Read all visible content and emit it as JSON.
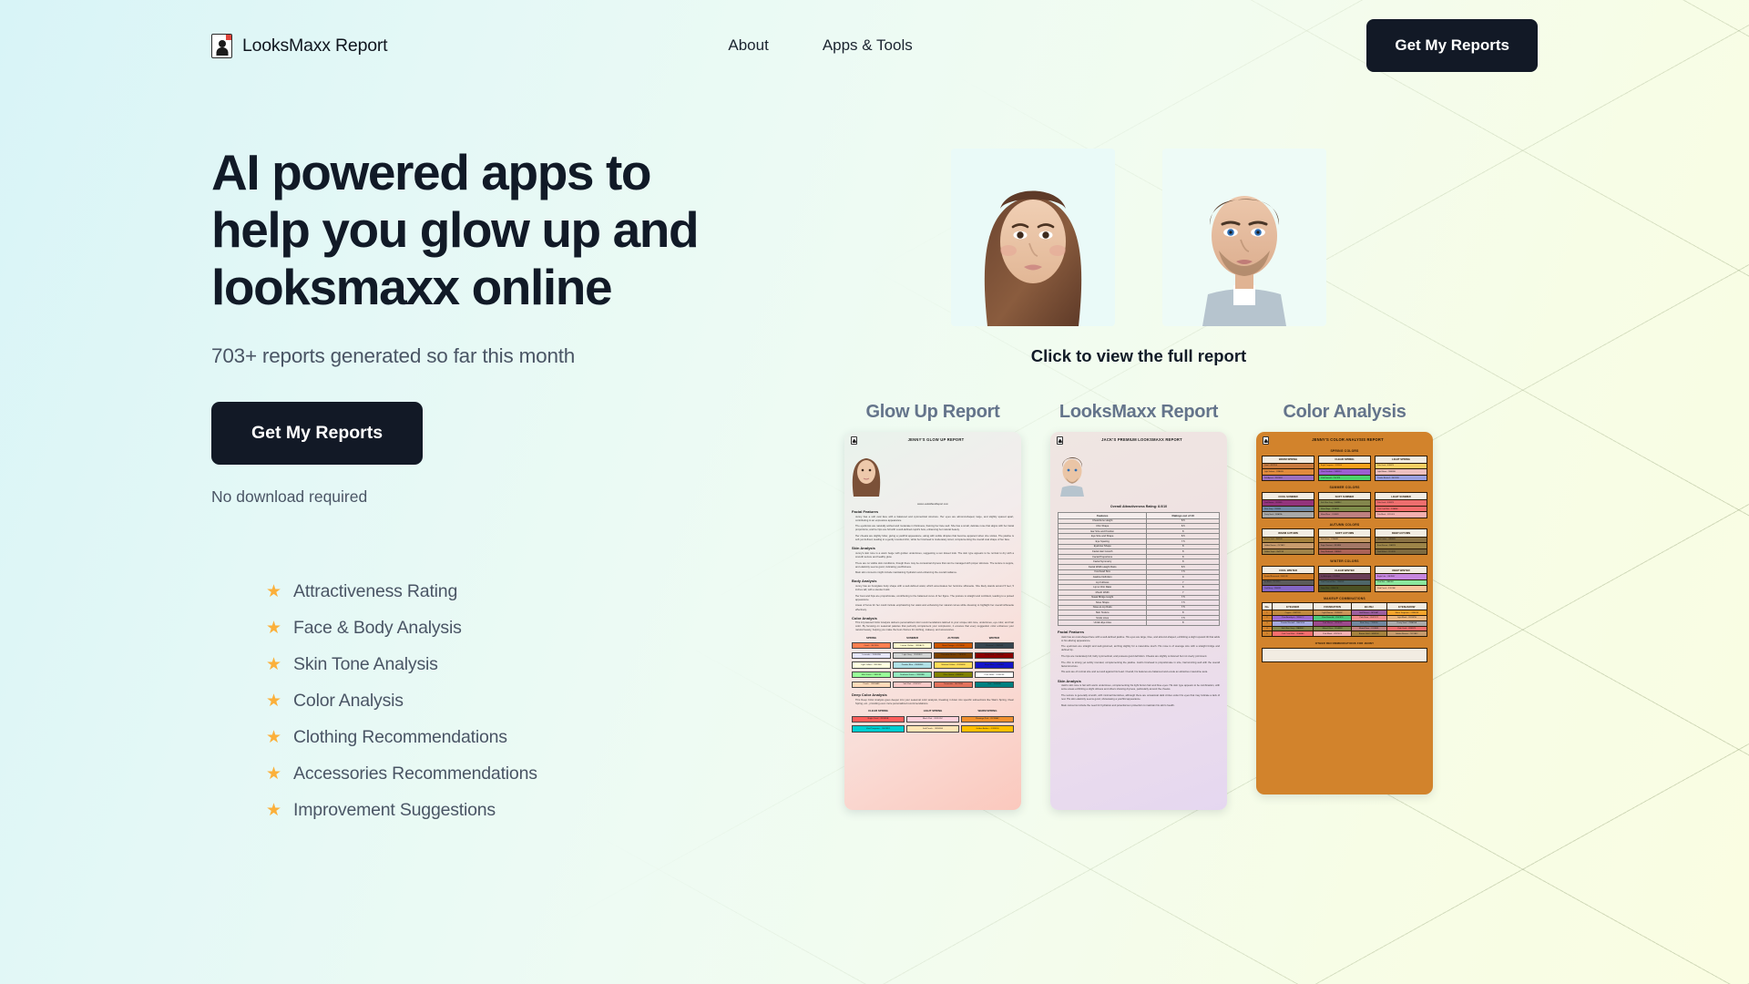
{
  "header": {
    "brand_name": "LooksMaxx Report",
    "brand_logo_icon": "report-person-icon",
    "nav": [
      {
        "label": "About"
      },
      {
        "label": "Apps & Tools"
      }
    ],
    "cta_label": "Get My Reports"
  },
  "hero": {
    "heading": "AI powered apps to help you glow up and looksmaxx online",
    "subheading": "703+ reports generated so far this month",
    "cta_label": "Get My Reports",
    "note": "No download required",
    "features": [
      {
        "icon": "star-icon",
        "label": "Attractiveness Rating"
      },
      {
        "icon": "star-icon",
        "label": "Face & Body Analysis"
      },
      {
        "icon": "star-icon",
        "label": "Skin Tone Analysis"
      },
      {
        "icon": "star-icon",
        "label": "Color Analysis"
      },
      {
        "icon": "star-icon",
        "label": "Clothing Recommendations"
      },
      {
        "icon": "star-icon",
        "label": "Accessories Recommendations"
      },
      {
        "icon": "star-icon",
        "label": "Improvement Suggestions"
      }
    ],
    "star_color": "#fbb03b",
    "accent_dark": "#121926"
  },
  "showcase": {
    "click_note": "Click to view the full report",
    "portraits": [
      {
        "alt": "female-portrait"
      },
      {
        "alt": "male-portrait"
      }
    ],
    "cards": [
      {
        "title": "Glow Up Report"
      },
      {
        "title": "LooksMaxx Report"
      },
      {
        "title": "Color Analysis"
      }
    ]
  },
  "glow_up_report": {
    "title": "JENNY'S GLOW UP REPORT",
    "url": "www.LooksMaxxReport.com",
    "sections": [
      {
        "heading": "Facial Features",
        "paragraphs": [
          "Jenny has a soft oval face with a balanced and symmetrical structure. Her eyes are almond-shaped, large, and slightly spaced apart, contributing to an expressive appearance.",
          "The eyebrows are naturally arched and moderate in thickness, framing her face well. She has a small, delicate nose that aligns with her facial proportions, and her lips are full with a well-defined cupid's bow, enhancing her natural beauty.",
          "Her cheeks are slightly fuller, giving a youthful appearance, along with subtle dimples that become apparent when she smiles. The jawline is soft yet defined, leading to a gently rounded chin, while her forehead is moderately sized, complementing the overall oval shape of her face."
        ]
      },
      {
        "heading": "Skin Analysis",
        "paragraphs": [
          "Jenny's skin tone is a warm beige with golden undertones, suggesting a sun kissed look. The skin type appears to be normal to dry with a smooth texture and healthy glow.",
          "There are no visible skin conditions, though there may be occasional dryness that can be managed with proper skincare. The texture is supple, and elasticity seems good, indicating youthfulness.",
          "Main skin concerns might include maintaining hydration and enhancing the overall radiance."
        ]
      },
      {
        "heading": "Body Analysis",
        "paragraphs": [
          "Jenny has an hourglass body shape with a well-defined waist, which accentuates her feminine silhouette. She likely stands around 5 feet, 5 inches tall, with a slender build.",
          "Her bust and hips are proportionate, contributing to the balanced curve of her figure. The posture is straight and confident, leading to a poised appearance.",
          "Areas of focus for her could include emphasizing her waist and enhancing her natural curves while dressing to highlight her overall silhouette effectively."
        ]
      },
      {
        "heading": "Color Analysis",
        "paragraphs": [
          "This AI powered Color Analysis delivers personalized color recommendations tailored to your unique skin tone, undertones, eye color, and hair color. By focusing on seasonal palettes that perfectly complement your complexion, it ensures that every suggestion color enhances your natural beauty, helping you make the best choices for clothing, makeup, and accessories."
        ]
      }
    ],
    "season_columns": [
      "SPRING",
      "SUMMER",
      "AUTUMN",
      "WINTER"
    ],
    "season_swatches": [
      [
        {
          "label": "Coral - #FF7F50",
          "color": "#FF7F50"
        },
        {
          "label": "Lavender - #E6E6FA",
          "color": "#E6E6FA"
        },
        {
          "label": "Light Yellow - #FFFFE0",
          "color": "#FFFFE0"
        },
        {
          "label": "Mint Green - #98FF98",
          "color": "#98FF98"
        },
        {
          "label": "Peach - #FFDAB9",
          "color": "#FFDAB9"
        }
      ],
      [
        {
          "label": "Lemon Chiffon - #FFFACD",
          "color": "#FFFACD"
        },
        {
          "label": "Light Grey - #D3D3D3",
          "color": "#D3D3D3"
        },
        {
          "label": "Powder Blue - #B0E0E6",
          "color": "#B0E0E6"
        },
        {
          "label": "Seafoam Green - #93E9BE",
          "color": "#93E9BE"
        },
        {
          "label": "Soft Pink - #F9C9C7",
          "color": "#F9C9C7"
        }
      ],
      [
        {
          "label": "Burnt Orange - #CC5500",
          "color": "#CC5500"
        },
        {
          "label": "Chocolate Brown - #7B3F00",
          "color": "#7B3F00"
        },
        {
          "label": "Mustard Yellow - #FFDB58",
          "color": "#FFDB58"
        },
        {
          "label": "Olive Green - #808000",
          "color": "#808000"
        },
        {
          "label": "Terracotta - #E2725B",
          "color": "#E2725B"
        }
      ],
      [
        {
          "label": "Charcoal - #36454F",
          "color": "#36454F"
        },
        {
          "label": "Deep Red - #8B0000",
          "color": "#8B0000"
        },
        {
          "label": "Royal Blue - #4169E1",
          "color": "#1414c8"
        },
        {
          "label": "Pure White - #FFFFFF",
          "color": "#FFFFFF"
        },
        {
          "label": "Teal - #008080",
          "color": "#008080"
        }
      ]
    ],
    "deep_section": {
      "heading": "Deep Color Analysis",
      "paragraph": "This Deep Color Analysis goes deeper into your seasonal color analysis, breaking it down into specific subsections like Warm Spring, Clear Spring, etc., providing even more personalized recommendations.",
      "columns": [
        "CLEAR SPRING",
        "LIGHT SPRING",
        "WARM SPRING"
      ],
      "swatches": [
        [
          {
            "label": "Bright Coral - #FF5E5B",
            "color": "#FF5E5B"
          },
          {
            "label": "Vivid Turquoise - #00CED1",
            "color": "#00CED1"
          }
        ],
        [
          {
            "label": "Blush Pink - #FFD1DC",
            "color": "#FFD1DC"
          },
          {
            "label": "Soft Peach - #FFE5B4",
            "color": "#FFE5B4"
          }
        ],
        [
          {
            "label": "Flamingo Pink - #FC8EAC",
            "color": "#F2902E"
          },
          {
            "label": "Golden Amber - #FFBF00",
            "color": "#FFBF00"
          }
        ]
      ]
    }
  },
  "looksmaxx_report": {
    "title": "JACK'S PREMIUM LOOKSMAXX REPORT",
    "overall": "Overall Attractiveness Rating: 8.0/10",
    "table_headers": [
      "Features",
      "Ratings out of 10"
    ],
    "rows": [
      {
        "feature": "Cheekbone Height",
        "rating": "8.5"
      },
      {
        "feature": "Chin Shape",
        "rating": "8.5"
      },
      {
        "feature": "Ear Size and Position",
        "rating": "8"
      },
      {
        "feature": "Eye Size and Shape",
        "rating": "8.5"
      },
      {
        "feature": "Eye Spacing",
        "rating": "7.5"
      },
      {
        "feature": "Eyebrow Shape",
        "rating": "8"
      },
      {
        "feature": "Facial Hair Growth",
        "rating": "8"
      },
      {
        "feature": "Facial Proportions",
        "rating": "8"
      },
      {
        "feature": "Facial Symmetry",
        "rating": "8"
      },
      {
        "feature": "Facial Width-Height Ratio",
        "rating": "8.5"
      },
      {
        "feature": "Forehead Size",
        "rating": "7.5"
      },
      {
        "feature": "Jawline Definition",
        "rating": "9"
      },
      {
        "feature": "Lip Fullness",
        "rating": "7"
      },
      {
        "feature": "Lip to Chin Ratio",
        "rating": "8"
      },
      {
        "feature": "Mouth Width",
        "rating": "7"
      },
      {
        "feature": "Nasal Bridge Height",
        "rating": "7.5"
      },
      {
        "feature": "Nose Shape",
        "rating": "7.5"
      },
      {
        "feature": "Nose-to-Lip Ratio",
        "rating": "7.5"
      },
      {
        "feature": "Skin Texture",
        "rating": "8"
      },
      {
        "feature": "Smile Lines",
        "rating": "7.5"
      },
      {
        "feature": "Under-Eye Area",
        "rating": "8"
      }
    ],
    "sections": [
      {
        "heading": "Facial Features",
        "paragraphs": [
          "Jack has an oval-shaped face with a well-defined jawline. His eyes are large, blue, and almond-shaped, exhibiting a slight upward tilt that adds to his alluring appearance.",
          "The eyebrows are straight and well-groomed, arching slightly for a masculine touch. His nose is of average size with a straight bridge and defined tip.",
          "The lips are moderately full, fairly symmetrical, and possess good definition. Cheeks are slightly contoured but not overly prominent.",
          "The chin is strong yet subtly rounded, complementing the jawline. Jack's forehead is proportionate in size, harmonizing well with the overall facial structure.",
          "His ears are of normal size and set well against his head. Overall, his features are balanced and exude an attractive masculine aura."
        ]
      },
      {
        "heading": "Skin Analysis",
        "paragraphs": [
          "Jack's skin tone is fair with warm undertones, complementing his light brown hair and blue eyes. His skin type appears to be combination, with some areas exhibiting a slight oiliness and others showing dryness, particularly around the cheeks.",
          "The texture is generally smooth, with minimal blemishes, although there are occasional dark circles under his eyes that may indicate a lack of rest. His skin elasticity seems good, showcasing a youthful appearance.",
          "Main concerns include the need for hydration and potential sun protection to maintain his skin's health."
        ]
      }
    ]
  },
  "color_analysis_report": {
    "title": "JENNY'S COLOR ANALYSIS REPORT",
    "background_color": "#d2832c",
    "seasons": [
      {
        "name": "SPRING COLORS",
        "groups": [
          {
            "name": "WARM SPRING",
            "swatches": [
              {
                "label": "Coral - #FF7F50",
                "color": "#C97B3F"
              },
              {
                "label": "Light Salmon - #FFA07A",
                "color": "#E08A3C"
              },
              {
                "label": "Soft Apricot - #FBCEB1",
                "color": "#9B6FBF"
              }
            ]
          },
          {
            "name": "CLEAR SPRING",
            "swatches": [
              {
                "label": "Bright Tangerine - #F28500",
                "color": "#F9A11B"
              },
              {
                "label": "Clear Cerulean - #2A9DF4",
                "color": "#9C5FD0"
              },
              {
                "label": "Vivid Emerald - #50C878",
                "color": "#4BD36B"
              }
            ]
          },
          {
            "name": "LIGHT SPRING",
            "swatches": [
              {
                "label": "Pale Coral - #F88379",
                "color": "#F7CF63"
              },
              {
                "label": "Light Bloom - #E6E6FA",
                "color": "#EDBFBF"
              },
              {
                "label": "Powder Bluebell - #B0C4DE",
                "color": "#9AA0E0"
              }
            ]
          }
        ]
      },
      {
        "name": "SUMMER COLORS",
        "groups": [
          {
            "name": "COOL SUMMER",
            "swatches": [
              {
                "label": "Cool Mauve - #915F6D",
                "color": "#93337C"
              },
              {
                "label": "Slate Grey - #708090",
                "color": "#6F89A5"
              },
              {
                "label": "Dusty Sand - #B8A99A",
                "color": "#A8A8A8"
              }
            ]
          },
          {
            "name": "SOFT SUMMER",
            "swatches": [
              {
                "label": "Soft Olive Grey - #8A8B6C",
                "color": "#83864C"
              },
              {
                "label": "Muted Sage - #9CAF88",
                "color": "#7E8C4B"
              },
              {
                "label": "Muted Rose - #C08081",
                "color": "#BE8080"
              }
            ]
          },
          {
            "name": "LIGHT SUMMER",
            "swatches": [
              {
                "label": "Pale Coral - #F88379",
                "color": "#ED6E6E"
              },
              {
                "label": "Cool Coral Mist - #F4A6A0",
                "color": "#F56B6B"
              },
              {
                "label": "Pale Blush - #F2C4C4",
                "color": "#F3AFAF"
              }
            ]
          }
        ]
      },
      {
        "name": "AUTUMN COLORS",
        "groups": [
          {
            "name": "WARM AUTUMN",
            "swatches": [
              {
                "label": "Bronze Gold - #A98540",
                "color": "#A5823E"
              },
              {
                "label": "Golden Bronze - #9C7A3C",
                "color": "#C79B6D"
              },
              {
                "label": "Golden Sepia - #A47C48",
                "color": "#A08349"
              }
            ]
          },
          {
            "name": "SOFT AUTUMN",
            "swatches": [
              {
                "label": "Soft Ochre - #C9A66B",
                "color": "#C59A64"
              },
              {
                "label": "Sage Chestnut - #8F7A5E",
                "color": "#A37766"
              },
              {
                "label": "Deep Redwood - #8B3A2F",
                "color": "#AB6258"
              }
            ]
          },
          {
            "name": "DEEP AUTUMN",
            "swatches": [
              {
                "label": "Dark Umber - #6B4A2E",
                "color": "#8A7244"
              },
              {
                "label": "Burnt Sienna - #8A3324",
                "color": "#9C8448"
              },
              {
                "label": "Dark Walnut - #5C4033",
                "color": "#7E6A3F"
              }
            ]
          }
        ]
      },
      {
        "name": "WINTER COLORS",
        "groups": [
          {
            "name": "COOL WINTER",
            "swatches": [
              {
                "label": "Frosted Rosewood - #B05C4D",
                "color": "#D07D28"
              },
              {
                "label": "Ice Black - #1C1C1C",
                "color": "#5B5B5B"
              },
              {
                "label": "Cool Berry - #8E4585",
                "color": "#8466C6"
              }
            ]
          },
          {
            "name": "CLEAR WINTER",
            "swatches": [
              {
                "label": "Icy Aubergine - #5D3954",
                "color": "#6A3E57"
              },
              {
                "label": "Cool Charcoal Blue - #36454F",
                "color": "#4E6668"
              },
              {
                "label": "Deep Olive - #3B3C1E",
                "color": "#4C5124"
              }
            ]
          },
          {
            "name": "DEEP WINTER",
            "swatches": [
              {
                "label": "Bright Lilac - #BE7BD7",
                "color": "#C787DF"
              },
              {
                "label": "Vivid Mint - #6AF2A1",
                "color": "#8BE79E"
              },
              {
                "label": "Vivid Peach - #FFC2A0",
                "color": "#F9C49B"
              }
            ]
          }
        ]
      }
    ],
    "makeup_title": "MAKEUP COMBINATIONS",
    "makeup_headers": [
      "No.",
      "EYELINER",
      "FOUNDATION",
      "BLUSH",
      "EYESHADOW"
    ],
    "makeup_rows": [
      {
        "no": "1",
        "cells": [
          {
            "label": "Copper - #B87333",
            "color": "#C08A3E"
          },
          {
            "label": "Light Bronze - #D2B48C",
            "color": "#C9955A"
          },
          {
            "label": "Soft Mauve - #B784A7",
            "color": "#9B5E9E"
          },
          {
            "label": "Warm Tangerine - #FFA138",
            "color": "#F5A42C"
          }
        ]
      },
      {
        "no": "2",
        "cells": [
          {
            "label": "Clear Amethyst - #9966CC",
            "color": "#9C6AD0"
          },
          {
            "label": "Clear Emerald - #50C878",
            "color": "#4CC97C"
          },
          {
            "label": "Pale Rose - #F4C2C2",
            "color": "#EF8C8C"
          },
          {
            "label": "Light Blush - #E9967A",
            "color": "#E8B47E"
          }
        ]
      },
      {
        "no": "3",
        "cells": [
          {
            "label": "Powder Bluebell - #B0C4DE",
            "color": "#A3A8DE"
          },
          {
            "label": "Cool Mauve - #915F6D",
            "color": "#9B4A8C"
          },
          {
            "label": "Slate Grey - #708090",
            "color": "#71879E"
          },
          {
            "label": "Dusty Sand - #B8A99A",
            "color": "#A9A9A9"
          }
        ]
      },
      {
        "no": "4",
        "cells": [
          {
            "label": "Soft Olive Grey - #8A8B6C",
            "color": "#83864C"
          },
          {
            "label": "Muted Olive - #9CAF88",
            "color": "#7C8A4B"
          },
          {
            "label": "Muted Rose - #C08081",
            "color": "#BE8080"
          },
          {
            "label": "Pale Coral - #F88379",
            "color": "#EE6F6F"
          }
        ]
      },
      {
        "no": "5",
        "cells": [
          {
            "label": "Cool Coral Mist - #F4A6A0",
            "color": "#F56E6E"
          },
          {
            "label": "Pale Blush - #F2C4C4",
            "color": "#F3AFAF"
          },
          {
            "label": "Bronze Gold - #A98540",
            "color": "#A5823E"
          },
          {
            "label": "Golden Bronze - #9C7A3C",
            "color": "#C69B6C"
          }
        ]
      }
    ],
    "other_title": "OTHER RECOMMENDATIONS FOR JENNY"
  }
}
